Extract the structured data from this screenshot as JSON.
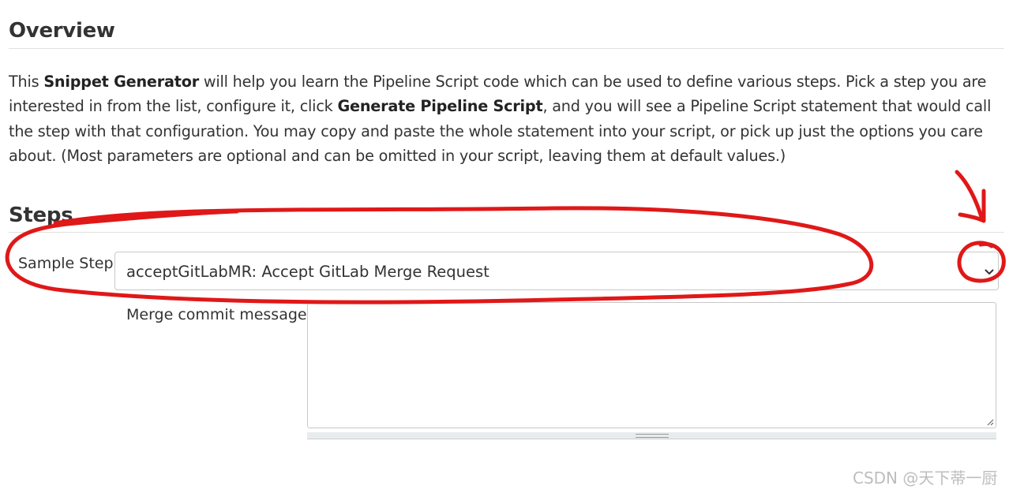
{
  "overview": {
    "heading": "Overview",
    "intro": {
      "p1": "This ",
      "snippet_generator": "Snippet Generator",
      "p2": " will help you learn the Pipeline Script code which can be used to define various steps. Pick a step you are interested in from the list, configure it, click ",
      "generate_pipeline_script": "Generate Pipeline Script",
      "p3": ", and you will see a Pipeline Script statement that would call the step with that configuration. You may copy and paste the whole statement into your script, or pick up just the options you care about. (Most parameters are optional and can be omitted in your script, leaving them at default values.)"
    }
  },
  "steps": {
    "heading": "Steps",
    "sample_step_label": "Sample Step",
    "sample_step_value": "acceptGitLabMR: Accept GitLab Merge Request",
    "merge_commit_label": "Merge commit message",
    "merge_commit_value": ""
  },
  "annotation": {
    "color": "#e01818"
  },
  "watermark": "CSDN @天下蒂一厨"
}
